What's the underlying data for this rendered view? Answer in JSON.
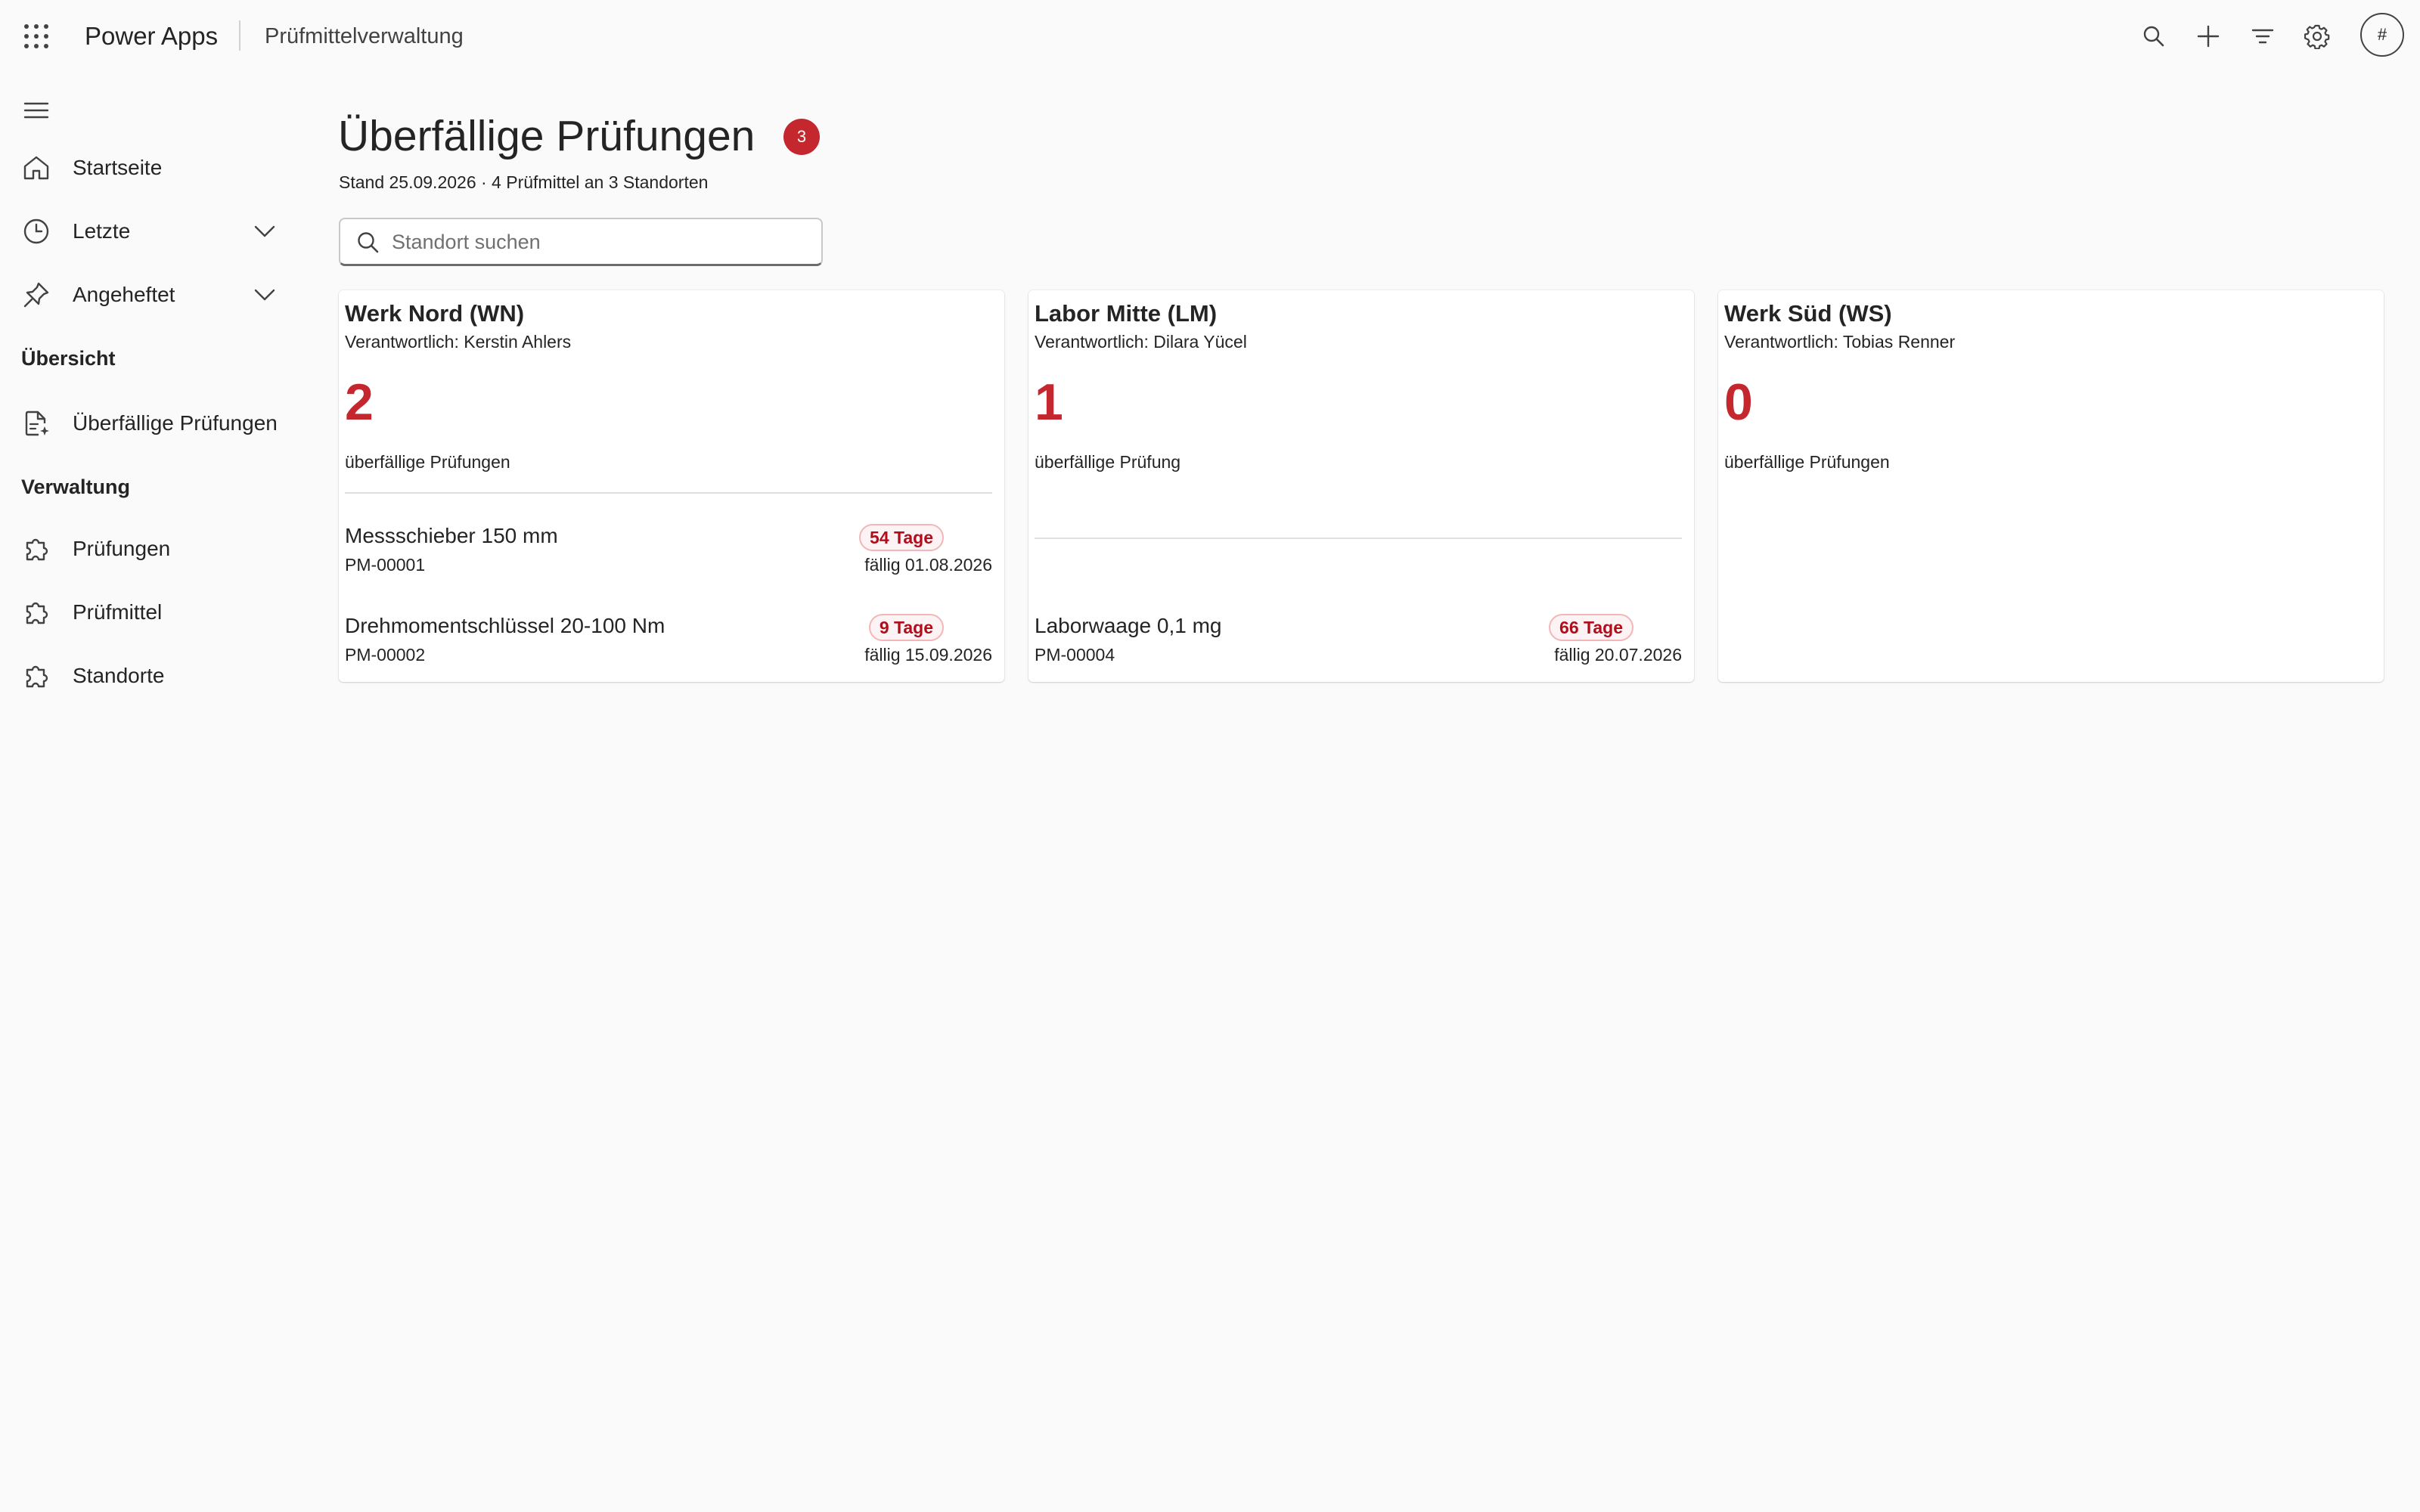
{
  "header": {
    "app_name": "Power Apps",
    "app_title": "Prüfmittelverwaltung",
    "avatar_initials": "#"
  },
  "sidebar": {
    "items": [
      {
        "label": "Startseite",
        "icon": "home-icon"
      },
      {
        "label": "Letzte",
        "icon": "clock-icon",
        "expandable": true
      },
      {
        "label": "Angeheftet",
        "icon": "pin-icon",
        "expandable": true
      }
    ],
    "sections": [
      {
        "title": "Übersicht",
        "items": [
          {
            "label": "Überfällige Prüfungen",
            "icon": "document-sparkle-icon"
          }
        ]
      },
      {
        "title": "Verwaltung",
        "items": [
          {
            "label": "Prüfungen",
            "icon": "puzzle-icon"
          },
          {
            "label": "Prüfmittel",
            "icon": "puzzle-icon"
          },
          {
            "label": "Standorte",
            "icon": "puzzle-icon"
          }
        ]
      }
    ]
  },
  "main": {
    "title": "Überfällige Prüfungen",
    "badge_count": "3",
    "subtitle": "Stand 25.09.2026 · 4 Prüfmittel an 3 Standorten",
    "search_placeholder": "Standort suchen",
    "cards": [
      {
        "name": "Werk Nord (WN)",
        "responsible": "Verantwortlich: Kerstin Ahlers",
        "count": "2",
        "count_label": "überfällige Prüfungen",
        "items": [
          {
            "name": "Messschieber 150 mm",
            "id": "PM-00001",
            "days": "54 Tage",
            "due": "fällig 01.08.2026"
          },
          {
            "name": "Drehmomentschlüssel 20-100 Nm",
            "id": "PM-00002",
            "days": "9 Tage",
            "due": "fällig 15.09.2026"
          }
        ]
      },
      {
        "name": "Labor Mitte (LM)",
        "responsible": "Verantwortlich: Dilara Yücel",
        "count": "1",
        "count_label": "überfällige Prüfung",
        "items": [
          {
            "name": "Laborwaage 0,1 mg",
            "id": "PM-00004",
            "days": "66 Tage",
            "due": "fällig 20.07.2026"
          }
        ]
      },
      {
        "name": "Werk Süd (WS)",
        "responsible": "Verantwortlich: Tobias Renner",
        "count": "0",
        "count_label": "überfällige Prüfungen",
        "items": []
      }
    ]
  },
  "colors": {
    "accent_red": "#c4272d",
    "badge_text": "#b10e1c",
    "badge_border": "#f3b6b8",
    "background": "#fafafa"
  }
}
